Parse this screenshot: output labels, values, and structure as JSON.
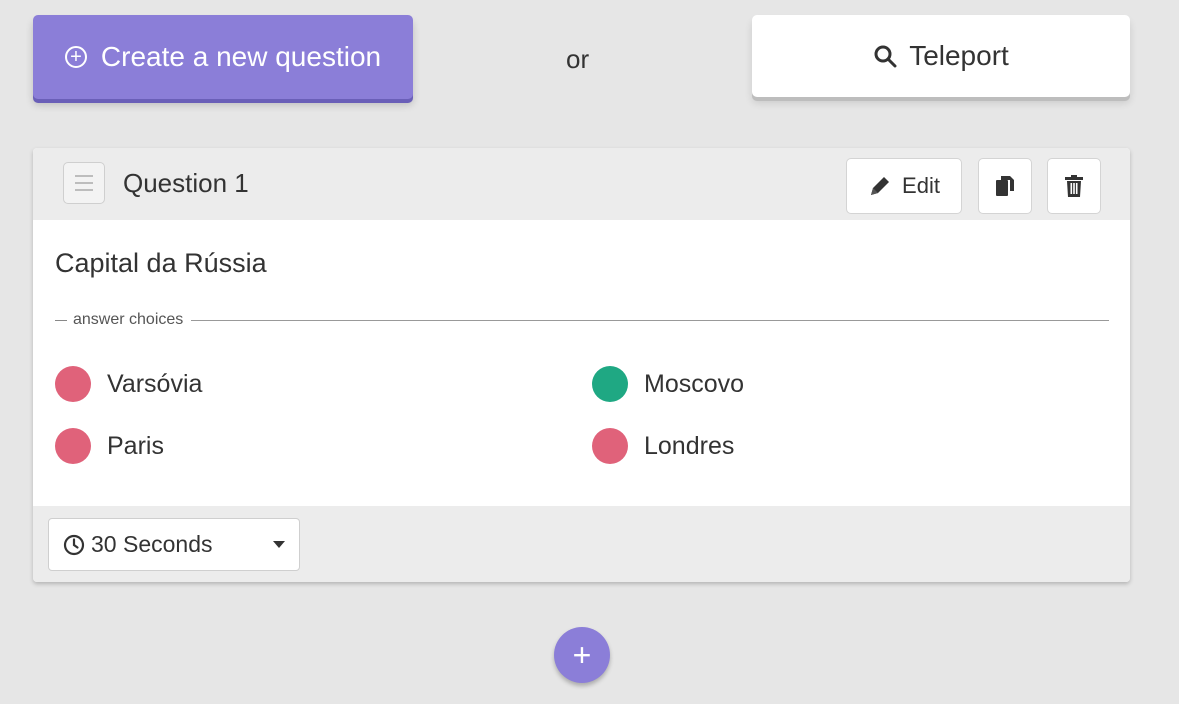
{
  "toolbar": {
    "create_label": "Create a new question",
    "or_text": "or",
    "teleport_label": "Teleport"
  },
  "question_card": {
    "title": "Question 1",
    "edit_label": "Edit",
    "question_text": "Capital da Rússia",
    "answers_divider_label": "answer choices",
    "answers": [
      {
        "text": "Varsóvia",
        "correct": false
      },
      {
        "text": "Moscovo",
        "correct": true
      },
      {
        "text": "Paris",
        "correct": false
      },
      {
        "text": "Londres",
        "correct": false
      }
    ],
    "timer_value": "30 Seconds"
  },
  "icons": {
    "create": "plus-circle-icon",
    "teleport": "search-icon",
    "drag": "drag-handle-icon",
    "edit": "pencil-icon",
    "copy": "copy-icon",
    "delete": "trash-icon",
    "timer": "clock-icon",
    "dropdown": "caret-down-icon",
    "add": "plus-icon"
  },
  "colors": {
    "accent": "#8b7ed8",
    "correct": "#1fa883",
    "incorrect": "#e0627a"
  }
}
